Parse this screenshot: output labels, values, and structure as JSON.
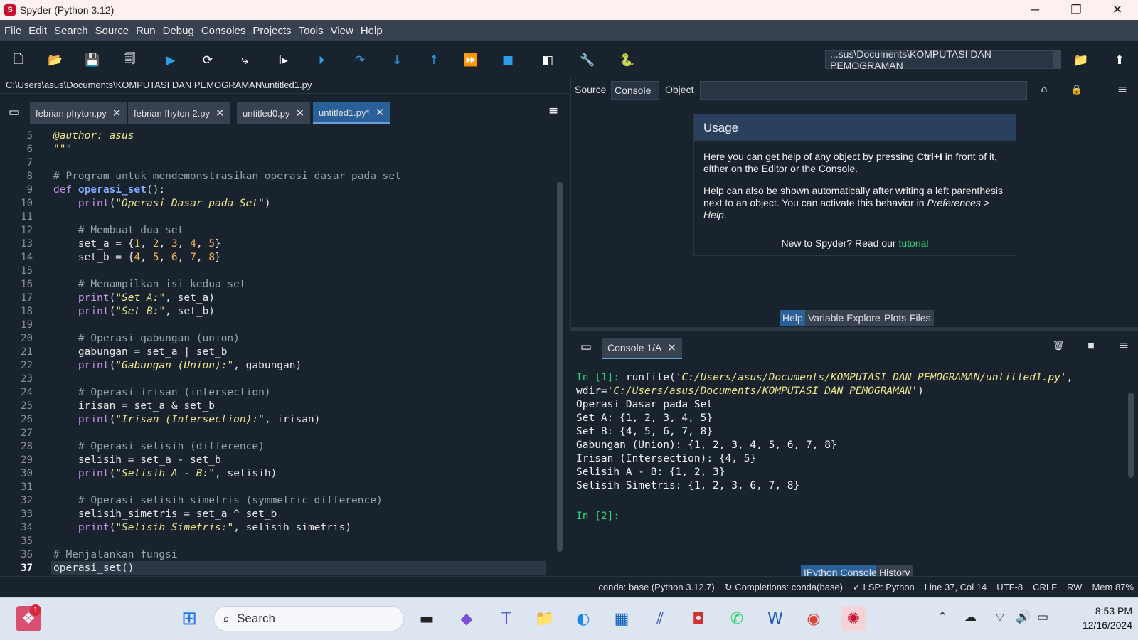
{
  "window": {
    "title": "Spyder (Python 3.12)",
    "app_icon": "spyder-icon",
    "minimize": "─",
    "maximize": "❐",
    "close": "✕"
  },
  "menu": [
    "File",
    "Edit",
    "Search",
    "Source",
    "Run",
    "Debug",
    "Consoles",
    "Projects",
    "Tools",
    "View",
    "Help"
  ],
  "toolbar": {
    "working_dir": "...sus\\Documents\\KOMPUTASI DAN PEMOGRAMAN",
    "icons": [
      "new-file-icon",
      "open-file-icon",
      "save-icon",
      "save-all-icon",
      "run-icon",
      "run-cell-icon",
      "run-cell-advance-icon",
      "run-selection-icon",
      "debug-file-icon",
      "debug-step-icon",
      "debug-step-into-icon",
      "debug-step-return-icon",
      "debug-continue-icon",
      "debug-stop-icon",
      "maximize-pane-icon",
      "preferences-icon",
      "python-path-icon",
      "browse-folder-icon",
      "parent-dir-icon"
    ]
  },
  "editor": {
    "path": "C:\\Users\\asus\\Documents\\KOMPUTASI DAN PEMOGRAMAN\\untitled1.py",
    "tabs": [
      {
        "label": "febrian phyton.py"
      },
      {
        "label": "febrian fhyton 2.py"
      },
      {
        "label": "untitled0.py"
      },
      {
        "label": "untitled1.py*"
      }
    ],
    "current_line": "37",
    "lines": [
      {
        "n": "5",
        "t": "@author: asus"
      },
      {
        "n": "6",
        "t": "\"\"\""
      },
      {
        "n": "7",
        "t": ""
      },
      {
        "n": "8",
        "t": "# Program untuk mendemonstrasikan operasi dasar pada set"
      },
      {
        "n": "9",
        "t": "def operasi_set():"
      },
      {
        "n": "10",
        "t": "    print(\"Operasi Dasar pada Set\")"
      },
      {
        "n": "11",
        "t": ""
      },
      {
        "n": "12",
        "t": "    # Membuat dua set"
      },
      {
        "n": "13",
        "t": "    set_a = {1, 2, 3, 4, 5}"
      },
      {
        "n": "14",
        "t": "    set_b = {4, 5, 6, 7, 8}"
      },
      {
        "n": "15",
        "t": ""
      },
      {
        "n": "16",
        "t": "    # Menampilkan isi kedua set"
      },
      {
        "n": "17",
        "t": "    print(\"Set A:\", set_a)"
      },
      {
        "n": "18",
        "t": "    print(\"Set B:\", set_b)"
      },
      {
        "n": "19",
        "t": ""
      },
      {
        "n": "20",
        "t": "    # Operasi gabungan (union)"
      },
      {
        "n": "21",
        "t": "    gabungan = set_a | set_b"
      },
      {
        "n": "22",
        "t": "    print(\"Gabungan (Union):\", gabungan)"
      },
      {
        "n": "23",
        "t": ""
      },
      {
        "n": "24",
        "t": "    # Operasi irisan (intersection)"
      },
      {
        "n": "25",
        "t": "    irisan = set_a & set_b"
      },
      {
        "n": "26",
        "t": "    print(\"Irisan (Intersection):\", irisan)"
      },
      {
        "n": "27",
        "t": ""
      },
      {
        "n": "28",
        "t": "    # Operasi selisih (difference)"
      },
      {
        "n": "29",
        "t": "    selisih = set_a - set_b"
      },
      {
        "n": "30",
        "t": "    print(\"Selisih A - B:\", selisih)"
      },
      {
        "n": "31",
        "t": ""
      },
      {
        "n": "32",
        "t": "    # Operasi selisih simetris (symmetric difference)"
      },
      {
        "n": "33",
        "t": "    selisih_simetris = set_a ^ set_b"
      },
      {
        "n": "34",
        "t": "    print(\"Selisih Simetris:\", selisih_simetris)"
      },
      {
        "n": "35",
        "t": ""
      },
      {
        "n": "36",
        "t": "# Menjalankan fungsi"
      },
      {
        "n": "37",
        "t": "operasi_set()"
      }
    ]
  },
  "help": {
    "source_label": "Source",
    "source_value": "Console",
    "object_label": "Object",
    "object_value": "",
    "usage_title": "Usage",
    "p1a": "Here you can get help of any object by pressing ",
    "p1b": "Ctrl+I",
    "p1c": " in front of it, either on the Editor or the Console.",
    "p2a": "Help can also be shown automatically after writing a left parenthesis next to an object. You can activate this behavior in ",
    "p2b": "Preferences > Help",
    "p2c": ".",
    "foot_a": "New to Spyder? Read our ",
    "foot_link": "tutorial",
    "pane_tabs": [
      "Help",
      "Variable Explorer",
      "Plots",
      "Files"
    ]
  },
  "console": {
    "tab": "Console 1/A",
    "in1": "In [1]: ",
    "run_a": "runfile(",
    "run_path": "'C:/Users/asus/Documents/KOMPUTASI DAN PEMOGRAMAN/untitled1.py'",
    "run_b": ",",
    "wdir_a": "wdir=",
    "wdir_path": "'C:/Users/asus/Documents/KOMPUTASI DAN PEMOGRAMAN'",
    "wdir_b": ")",
    "output": [
      "Operasi Dasar pada Set",
      "Set A: {1, 2, 3, 4, 5}",
      "Set B: {4, 5, 6, 7, 8}",
      "Gabungan (Union): {1, 2, 3, 4, 5, 6, 7, 8}",
      "Irisan (Intersection): {4, 5}",
      "Selisih A - B: {1, 2, 3}",
      "Selisih Simetris: {1, 2, 3, 6, 7, 8}"
    ],
    "in2": "In [2]:",
    "pane_tabs": [
      "IPython Console",
      "History"
    ]
  },
  "status": {
    "env": "conda: base (Python 3.12.7)",
    "completions": "↻ Completions: conda(base)",
    "lsp": "✓ LSP: Python",
    "position": "Line 37, Col 14",
    "encoding": "UTF-8",
    "eol": "CRLF",
    "rw": "RW",
    "mem": "Mem 87%"
  },
  "taskbar": {
    "search_placeholder": "Search",
    "time": "8:53 PM",
    "date": "12/16/2024",
    "badge": "1"
  }
}
